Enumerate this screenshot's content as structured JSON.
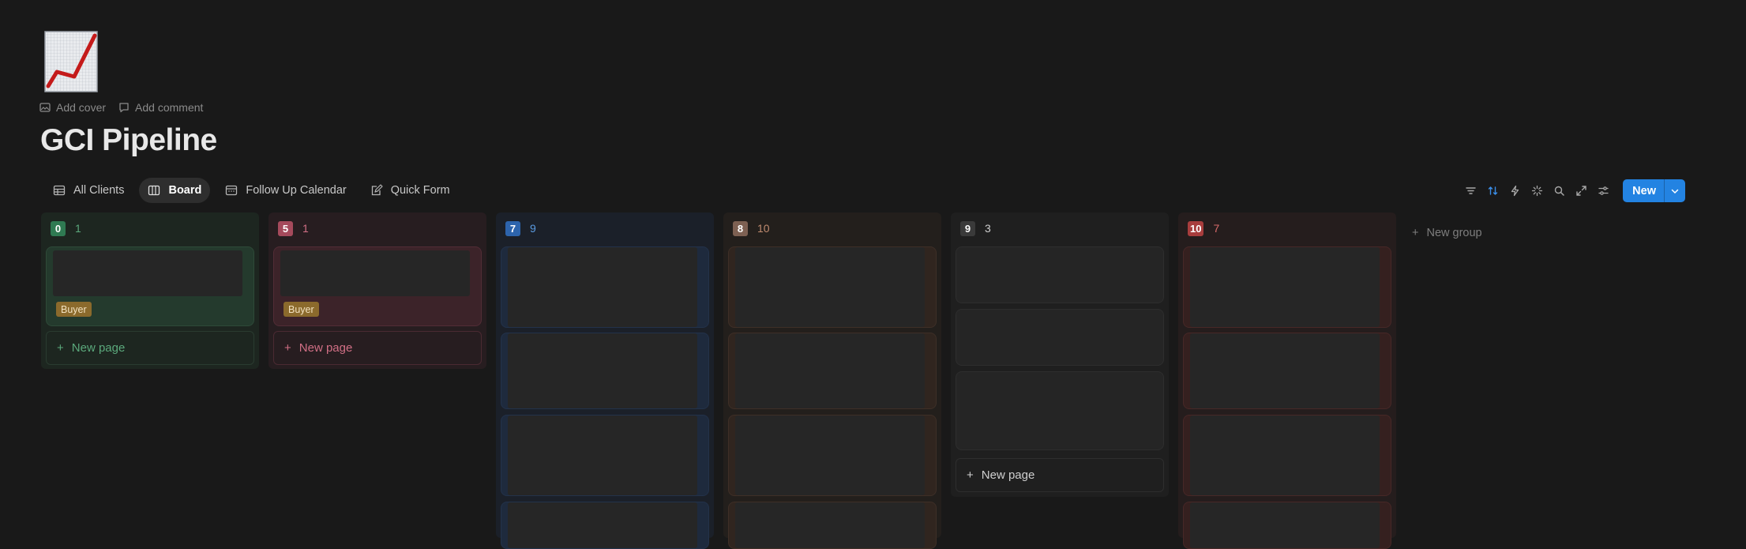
{
  "page": {
    "title": "GCI Pipeline",
    "icon": "chart-increasing-emoji",
    "actions": [
      {
        "label": "Add cover",
        "icon": "image-icon"
      },
      {
        "label": "Add comment",
        "icon": "comment-icon"
      }
    ]
  },
  "views": [
    {
      "label": "All Clients",
      "icon": "table-icon",
      "active": false
    },
    {
      "label": "Board",
      "icon": "board-icon",
      "active": true
    },
    {
      "label": "Follow Up Calendar",
      "icon": "calendar-icon",
      "active": false
    },
    {
      "label": "Quick Form",
      "icon": "form-icon",
      "active": false
    }
  ],
  "toolbar": {
    "icons": [
      "filter-icon",
      "sort-icon",
      "automation-icon",
      "ai-sparkle-icon",
      "search-icon",
      "expand-icon",
      "settings-icon"
    ],
    "new_label": "New",
    "accent": "#2383e2"
  },
  "columns": [
    {
      "label": "0",
      "count": "1",
      "color": "#2b6b4c",
      "card_tag": "Buyer",
      "new_page": "+ New page"
    },
    {
      "label": "5",
      "count": "1",
      "color": "#9a4453",
      "card_tag": "Buyer",
      "new_page": "+ New page"
    },
    {
      "label": "7",
      "count": "9",
      "color": "#2b5a98"
    },
    {
      "label": "8",
      "count": "10",
      "color": "#7a5a4c"
    },
    {
      "label": "9",
      "count": "3",
      "color": "#3a3a3a",
      "new_page": "+ New page"
    },
    {
      "label": "10",
      "count": "7",
      "color": "#a23a3a"
    }
  ],
  "new_group_label": "New group",
  "new_page_label": "New page"
}
